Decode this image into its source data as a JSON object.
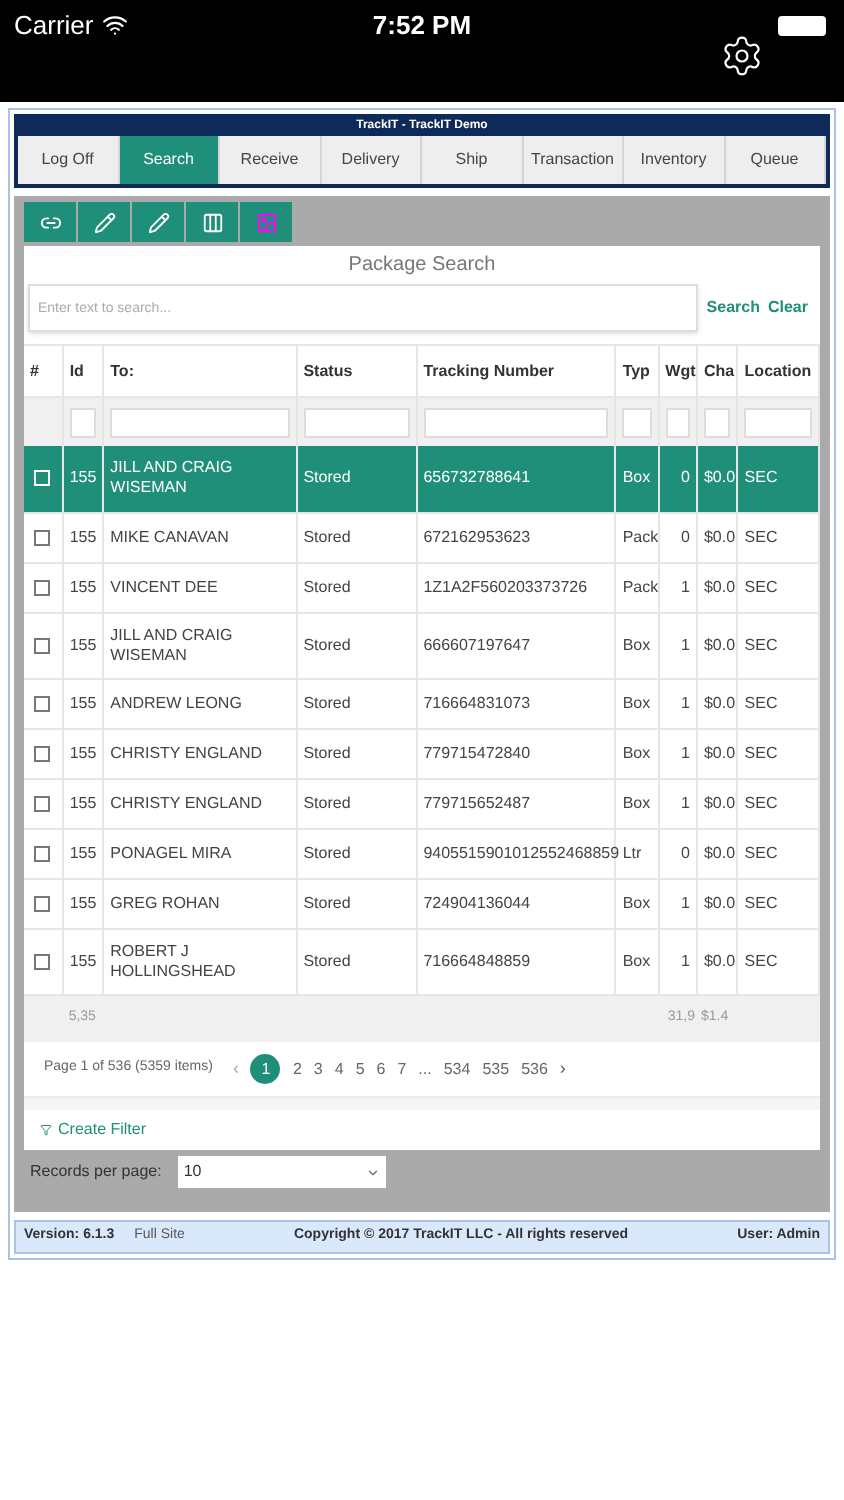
{
  "status_bar": {
    "carrier": "Carrier",
    "time": "7:52 PM"
  },
  "header": {
    "title": "TrackIT - TrackIT Demo"
  },
  "tabs": [
    {
      "label": "Log Off",
      "selected": false
    },
    {
      "label": "Search",
      "selected": true
    },
    {
      "label": "Receive",
      "selected": false
    },
    {
      "label": "Delivery",
      "selected": false
    },
    {
      "label": "Ship",
      "selected": false
    },
    {
      "label": "Transaction",
      "selected": false
    },
    {
      "label": "Inventory",
      "selected": false
    },
    {
      "label": "Queue",
      "selected": false
    }
  ],
  "panel": {
    "title": "Package Search",
    "search": {
      "placeholder": "Enter text to search..."
    },
    "search_button": "Search",
    "clear_button": "Clear"
  },
  "table": {
    "checkbox_header": "#",
    "columns": [
      "Id",
      "To:",
      "Status",
      "Tracking Number",
      "Typ",
      "Wgt",
      "Cha",
      "Location"
    ],
    "rows": [
      {
        "selected": true,
        "checked": false,
        "cells": [
          "155",
          "JILL AND CRAIG WISEMAN",
          "Stored",
          "656732788641",
          "Box",
          "0",
          "$0.0",
          "SEC"
        ]
      },
      {
        "selected": false,
        "checked": false,
        "cells": [
          "155",
          "MIKE CANAVAN",
          "Stored",
          "672162953623",
          "Pack",
          "0",
          "$0.0",
          "SEC"
        ]
      },
      {
        "selected": false,
        "checked": false,
        "cells": [
          "155",
          "VINCENT DEE",
          "Stored",
          "1Z1A2F560203373726",
          "Pack",
          "1",
          "$0.0",
          "SEC"
        ]
      },
      {
        "selected": false,
        "checked": false,
        "cells": [
          "155",
          "JILL AND CRAIG WISEMAN",
          "Stored",
          "666607197647",
          "Box",
          "1",
          "$0.0",
          "SEC"
        ]
      },
      {
        "selected": false,
        "checked": false,
        "cells": [
          "155",
          "ANDREW LEONG",
          "Stored",
          "716664831073",
          "Box",
          "1",
          "$0.0",
          "SEC"
        ]
      },
      {
        "selected": false,
        "checked": false,
        "cells": [
          "155",
          "CHRISTY ENGLAND",
          "Stored",
          "779715472840",
          "Box",
          "1",
          "$0.0",
          "SEC"
        ]
      },
      {
        "selected": false,
        "checked": false,
        "cells": [
          "155",
          "CHRISTY ENGLAND",
          "Stored",
          "779715652487",
          "Box",
          "1",
          "$0.0",
          "SEC"
        ]
      },
      {
        "selected": false,
        "checked": false,
        "cells": [
          "155",
          "PONAGEL MIRA",
          "Stored",
          "9405515901012552468859",
          "Ltr",
          "0",
          "$0.0",
          "SEC"
        ]
      },
      {
        "selected": false,
        "checked": false,
        "cells": [
          "155",
          "GREG ROHAN",
          "Stored",
          "724904136044",
          "Box",
          "1",
          "$0.0",
          "SEC"
        ]
      },
      {
        "selected": false,
        "checked": false,
        "cells": [
          "155",
          "ROBERT J HOLLINGSHEAD",
          "Stored",
          "716664848859",
          "Box",
          "1",
          "$0.0",
          "SEC"
        ]
      }
    ],
    "totals": {
      "id": "5,35",
      "wgt": "31,9",
      "charge": "$1.4"
    }
  },
  "pager": {
    "summary": "Page 1 of 536 (5359 items)",
    "prev": "‹",
    "next": "›",
    "pages": [
      {
        "label": "1",
        "selected": true
      },
      {
        "label": "2",
        "selected": false
      },
      {
        "label": "3",
        "selected": false
      },
      {
        "label": "4",
        "selected": false
      },
      {
        "label": "5",
        "selected": false
      },
      {
        "label": "6",
        "selected": false
      },
      {
        "label": "7",
        "selected": false
      },
      {
        "label": "...",
        "selected": false
      },
      {
        "label": "534",
        "selected": false
      },
      {
        "label": "535",
        "selected": false
      },
      {
        "label": "536",
        "selected": false
      }
    ]
  },
  "create_filter": "Create Filter",
  "records_per_page": {
    "label": "Records per page:",
    "value": "10"
  },
  "footer": {
    "version": "Version: 6.1.3",
    "full_site": "Full Site",
    "copyright": "Copyright © 2017 TrackIT LLC - All rights reserved",
    "user": "User: Admin"
  }
}
